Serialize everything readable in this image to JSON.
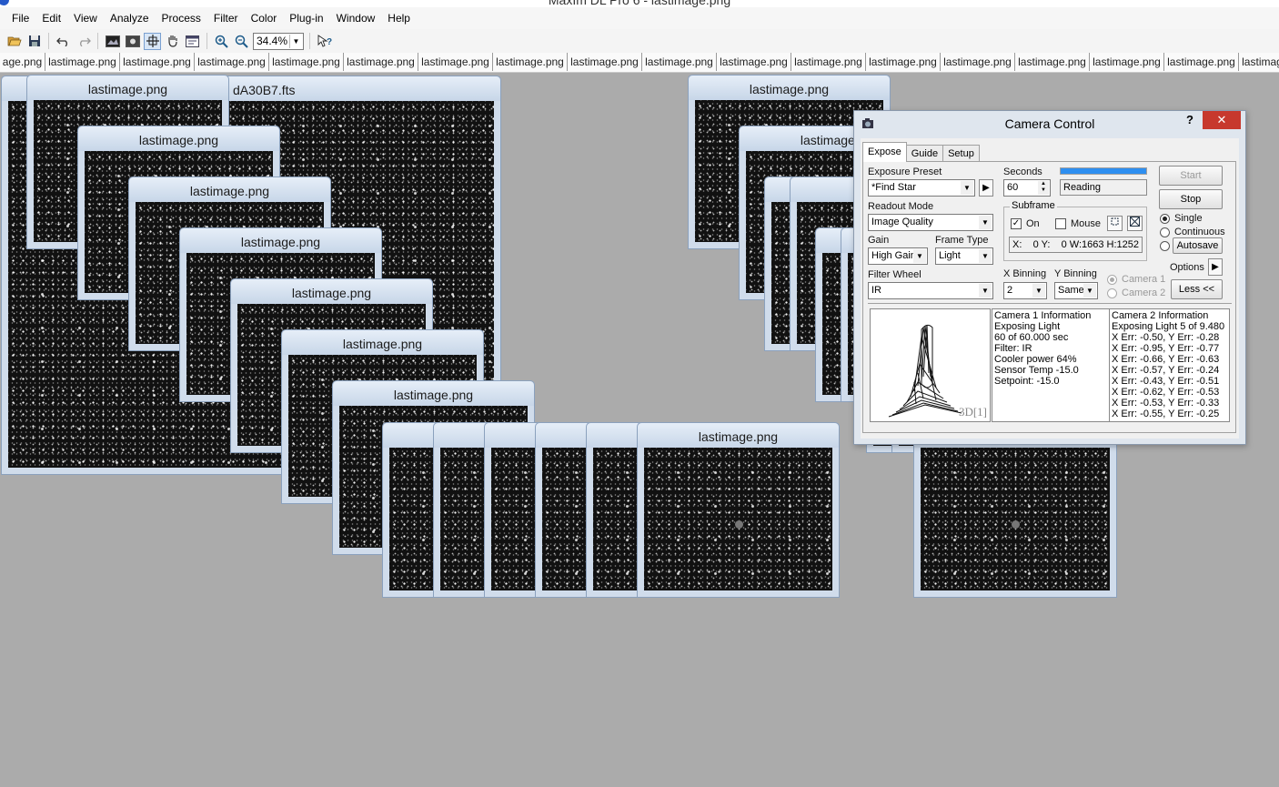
{
  "app": {
    "window_title": "MaxIm DL Pro 6 - lastimage.png"
  },
  "menu": [
    "File",
    "Edit",
    "View",
    "Analyze",
    "Process",
    "Filter",
    "Color",
    "Plug-in",
    "Window",
    "Help"
  ],
  "toolbar": {
    "zoom_value": "34.4%",
    "icons": [
      "open-icon",
      "save-icon",
      "undo-icon",
      "redo-icon",
      "screen-stretch-icon",
      "compare-icon",
      "crosshair-icon",
      "pan-hand-icon",
      "info-window-icon",
      "zoom-in-icon",
      "zoom-out-icon",
      "context-help-icon"
    ]
  },
  "tabs": [
    "age.png",
    "lastimage.png",
    "lastimage.png",
    "lastimage.png",
    "lastimage.png",
    "lastimage.png",
    "lastimage.png",
    "lastimage.png",
    "lastimage.png",
    "lastimage.png",
    "lastimage.png",
    "lastimage.png",
    "lastimage.png",
    "lastimage.png",
    "lastimage.png",
    "lastimage.png",
    "lastimage.png",
    "lastimage.png",
    "lastimag"
  ],
  "image_windows": {
    "fts_title": "dA30B7.fts",
    "png_title": "lastimage.png"
  },
  "camera_control": {
    "title": "Camera Control",
    "help": "?",
    "close": "✕",
    "tabs": [
      "Expose",
      "Guide",
      "Setup"
    ],
    "exposure_preset_label": "Exposure Preset",
    "exposure_preset_value": "*Find Star",
    "seconds_label": "Seconds",
    "seconds_value": "60",
    "progress_fraction": 1.0,
    "status_value": "Reading",
    "readout_mode_label": "Readout Mode",
    "readout_mode_value": "Image Quality",
    "subframe_label": "Subframe",
    "subframe_on_label": "On",
    "subframe_on_checked": true,
    "subframe_mouse_label": "Mouse",
    "subframe_mouse_checked": false,
    "subframe_value": "X:    0 Y:    0 W:1663 H:1252",
    "gain_label": "Gain",
    "gain_value": "High Gain",
    "frame_type_label": "Frame Type",
    "frame_type_value": "Light",
    "filter_wheel_label": "Filter Wheel",
    "filter_wheel_value": "IR",
    "x_binning_label": "X Binning",
    "x_binning_value": "2",
    "y_binning_label": "Y Binning",
    "y_binning_value": "Same",
    "camera1_label": "Camera 1",
    "camera2_label": "Camera 2",
    "start_label": "Start",
    "stop_label": "Stop",
    "mode_single": "Single",
    "mode_continuous": "Continuous",
    "autosave_label": "Autosave",
    "options_label": "Options",
    "less_label": "Less <<",
    "plot_tag": "3D[1]",
    "camera1_info": [
      "Camera 1 Information",
      "Exposing Light",
      "60 of 60.000 sec",
      "Filter: IR",
      "Cooler power 64%",
      "Sensor Temp -15.0",
      "Setpoint: -15.0"
    ],
    "camera2_info": [
      "Camera 2 Information",
      "Exposing Light 5 of 9.480",
      "X Err: -0.50, Y Err: -0.28",
      "X Err: -0.95, Y Err: -0.77",
      "X Err: -0.66, Y Err: -0.63",
      "X Err: -0.57, Y Err: -0.24",
      "X Err: -0.43, Y Err: -0.51",
      "X Err: -0.62, Y Err: -0.53",
      "X Err: -0.53, Y Err: -0.33",
      "X Err: -0.55, Y Err: -0.25"
    ]
  }
}
